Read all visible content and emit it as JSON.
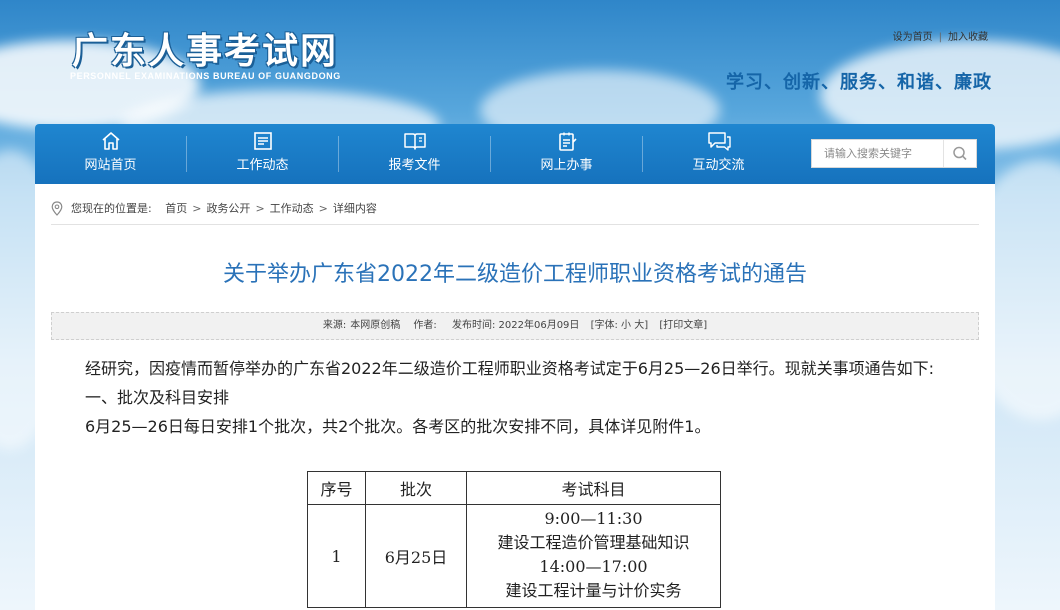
{
  "header": {
    "site_title": "广东人事考试网",
    "site_subtitle": "PERSONNEL EXAMINATIONS BUREAU OF GUANGDONG",
    "top_links": [
      "设为首页",
      "加入收藏"
    ],
    "slogan": "学习、创新、服务、和谐、廉政"
  },
  "nav": {
    "items": [
      {
        "label": "网站首页",
        "icon": "home-icon"
      },
      {
        "label": "工作动态",
        "icon": "news-icon"
      },
      {
        "label": "报考文件",
        "icon": "book-icon"
      },
      {
        "label": "网上办事",
        "icon": "clipboard-icon"
      },
      {
        "label": "互动交流",
        "icon": "chat-icon"
      }
    ],
    "search_placeholder": "请输入搜索关键字"
  },
  "breadcrumb": {
    "prefix": "您现在的位置是:",
    "items": [
      "首页",
      "政务公开",
      "工作动态",
      "详细内容"
    ]
  },
  "article": {
    "title": "关于举办广东省2022年二级造价工程师职业资格考试的通告",
    "meta": {
      "source": "来源:",
      "source_value": "本网原创稿",
      "author": "作者:",
      "published": "发布时间: 2022年06月09日",
      "font_size": "[字体: 小 大]",
      "print": "[打印文章]"
    },
    "paragraphs": [
      "经研究，因疫情而暂停举办的广东省2022年二级造价工程师职业资格考试定于6月25—26日举行。现就关事项通告如下:",
      "一、批次及科目安排",
      "6月25—26日每日安排1个批次，共2个批次。各考区的批次安排不同，具体详见附件1。"
    ],
    "table": {
      "headers": [
        "序号",
        "批次",
        "考试科目"
      ],
      "rows": [
        {
          "no": "1",
          "batch": "6月25日",
          "subjects": [
            "9:00—11:30",
            "建设工程造价管理基础知识",
            "14:00—17:00",
            "建设工程计量与计价实务"
          ]
        }
      ]
    }
  },
  "colors": {
    "nav_bar": "#1672bd",
    "title_blue": "#2a72b8",
    "slogan_blue": "#1565a8"
  }
}
